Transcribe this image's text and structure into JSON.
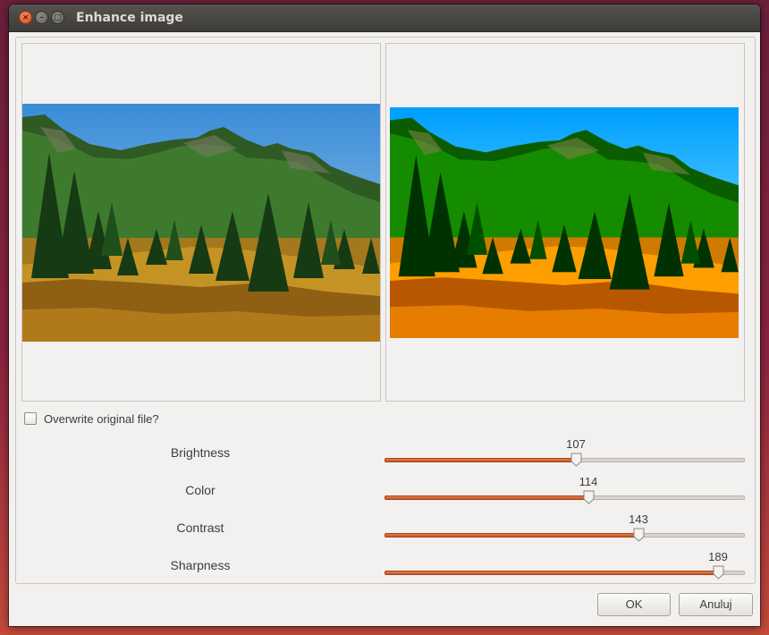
{
  "window": {
    "title": "Enhance image",
    "controls": {
      "close": "×",
      "minimize": "–",
      "maximize": "□"
    }
  },
  "preview": {
    "original_alt": "original mountain landscape",
    "enhanced_alt": "enhanced mountain landscape"
  },
  "overwrite": {
    "label": "Overwrite original file?",
    "checked": false
  },
  "sliders": {
    "brightness": {
      "label": "Brightness",
      "value": "107",
      "fraction": 0.53
    },
    "color": {
      "label": "Color",
      "value": "114",
      "fraction": 0.565
    },
    "contrast": {
      "label": "Contrast",
      "value": "143",
      "fraction": 0.705
    },
    "sharpness": {
      "label": "Sharpness",
      "value": "189",
      "fraction": 0.925
    }
  },
  "buttons": {
    "ok": "OK",
    "cancel": "Anuluj"
  },
  "colors": {
    "accent": "#d25a26",
    "titlebar": "#3c3b37"
  }
}
